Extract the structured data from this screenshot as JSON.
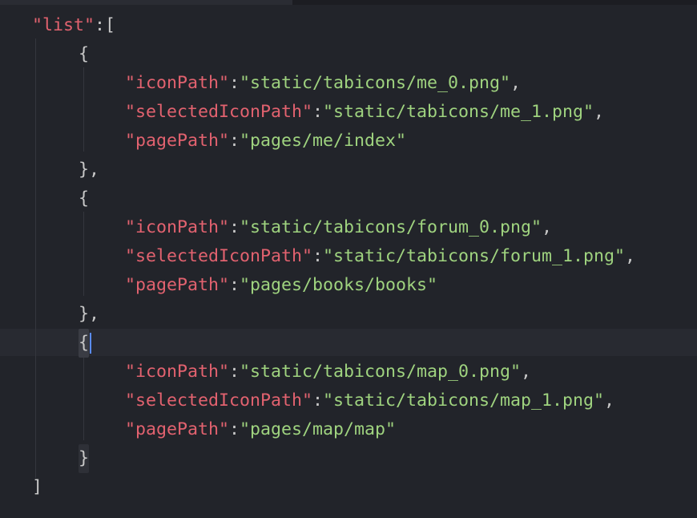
{
  "editor": {
    "lines": [
      {
        "id": "l1",
        "indent": 0,
        "parts": [
          [
            "key",
            "\"list\""
          ],
          [
            "pun",
            ":["
          ]
        ]
      },
      {
        "id": "l2",
        "indent": 1,
        "parts": [
          [
            "pun",
            "{"
          ]
        ]
      },
      {
        "id": "l3",
        "indent": 2,
        "parts": [
          [
            "key",
            "\"iconPath\""
          ],
          [
            "pun",
            ":"
          ],
          [
            "str",
            "\"static/tabicons/me_0.png\""
          ],
          [
            "pun",
            ","
          ]
        ]
      },
      {
        "id": "l4",
        "indent": 2,
        "parts": [
          [
            "key",
            "\"selectedIconPath\""
          ],
          [
            "pun",
            ":"
          ],
          [
            "str",
            "\"static/tabicons/me_1.png\""
          ],
          [
            "pun",
            ","
          ]
        ]
      },
      {
        "id": "l5",
        "indent": 2,
        "parts": [
          [
            "key",
            "\"pagePath\""
          ],
          [
            "pun",
            ":"
          ],
          [
            "str",
            "\"pages/me/index\""
          ]
        ]
      },
      {
        "id": "l6",
        "indent": 1,
        "parts": [
          [
            "pun",
            "},"
          ]
        ]
      },
      {
        "id": "l7",
        "indent": 1,
        "parts": [
          [
            "pun",
            "{"
          ]
        ]
      },
      {
        "id": "l8",
        "indent": 2,
        "parts": [
          [
            "key",
            "\"iconPath\""
          ],
          [
            "pun",
            ":"
          ],
          [
            "str",
            "\"static/tabicons/forum_0.png\""
          ],
          [
            "pun",
            ","
          ]
        ]
      },
      {
        "id": "l9",
        "indent": 2,
        "parts": [
          [
            "key",
            "\"selectedIconPath\""
          ],
          [
            "pun",
            ":"
          ],
          [
            "str",
            "\"static/tabicons/forum_1.png\""
          ],
          [
            "pun",
            ","
          ]
        ]
      },
      {
        "id": "l10",
        "indent": 2,
        "parts": [
          [
            "key",
            "\"pagePath\""
          ],
          [
            "pun",
            ":"
          ],
          [
            "str",
            "\"pages/books/books\""
          ]
        ]
      },
      {
        "id": "l11",
        "indent": 1,
        "parts": [
          [
            "pun",
            "},"
          ]
        ]
      },
      {
        "id": "l12",
        "indent": 1,
        "parts": [
          [
            "pun",
            "{"
          ]
        ],
        "current": true,
        "cursor": true,
        "matchBrace": true
      },
      {
        "id": "l13",
        "indent": 2,
        "parts": [
          [
            "key",
            "\"iconPath\""
          ],
          [
            "pun",
            ":"
          ],
          [
            "str",
            "\"static/tabicons/map_0.png\""
          ],
          [
            "pun",
            ","
          ]
        ]
      },
      {
        "id": "l14",
        "indent": 2,
        "parts": [
          [
            "key",
            "\"selectedIconPath\""
          ],
          [
            "pun",
            ":"
          ],
          [
            "str",
            "\"static/tabicons/map_1.png\""
          ],
          [
            "pun",
            ","
          ]
        ]
      },
      {
        "id": "l15",
        "indent": 2,
        "parts": [
          [
            "key",
            "\"pagePath\""
          ],
          [
            "pun",
            ":"
          ],
          [
            "str",
            "\"pages/map/map\""
          ]
        ]
      },
      {
        "id": "l16",
        "indent": 1,
        "parts": [
          [
            "pun",
            "}"
          ]
        ],
        "matchBraceDim": true
      },
      {
        "id": "l17",
        "indent": 0,
        "parts": [
          [
            "pun",
            "]"
          ]
        ]
      }
    ]
  },
  "colors": {
    "background": "#22242a",
    "key": "#e2626f",
    "string": "#9fd37f",
    "punctuation": "#c8c8c8",
    "cursor": "#5a8cff"
  }
}
